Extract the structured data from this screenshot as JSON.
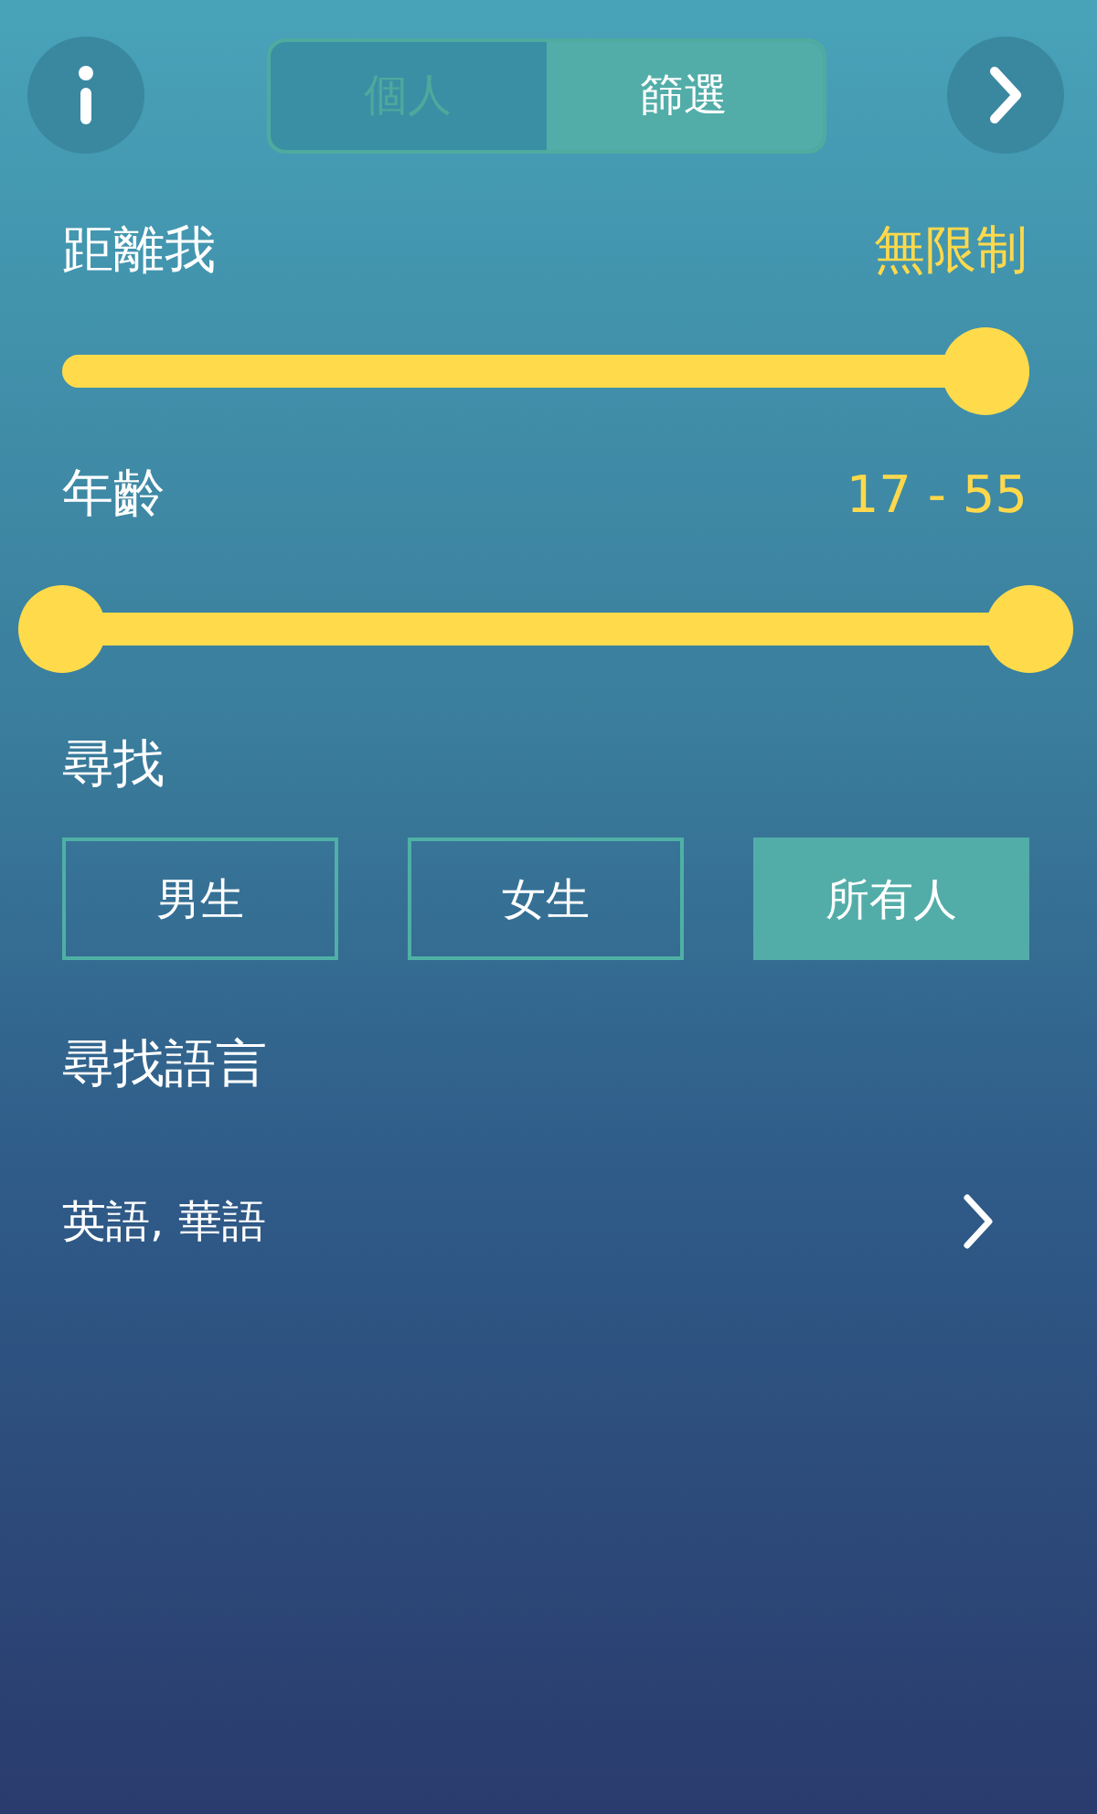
{
  "top_bar": {
    "tabs": [
      {
        "label": "個人",
        "selected": false
      },
      {
        "label": "篩選",
        "selected": true
      }
    ]
  },
  "distance": {
    "label": "距離我",
    "value": "無限制",
    "level": 1
  },
  "age": {
    "label": "年齡",
    "value": "17 - 55",
    "thumbs": [
      {
        "level": 0
      },
      {
        "level": 1
      }
    ]
  },
  "looking_for": {
    "label": "尋找",
    "options": [
      {
        "label": "男生",
        "selected": false
      },
      {
        "label": "女生",
        "selected": false
      },
      {
        "label": "所有人",
        "selected": true
      }
    ]
  },
  "languages": {
    "label": "尋找語言",
    "value": "英語, 華語"
  }
}
